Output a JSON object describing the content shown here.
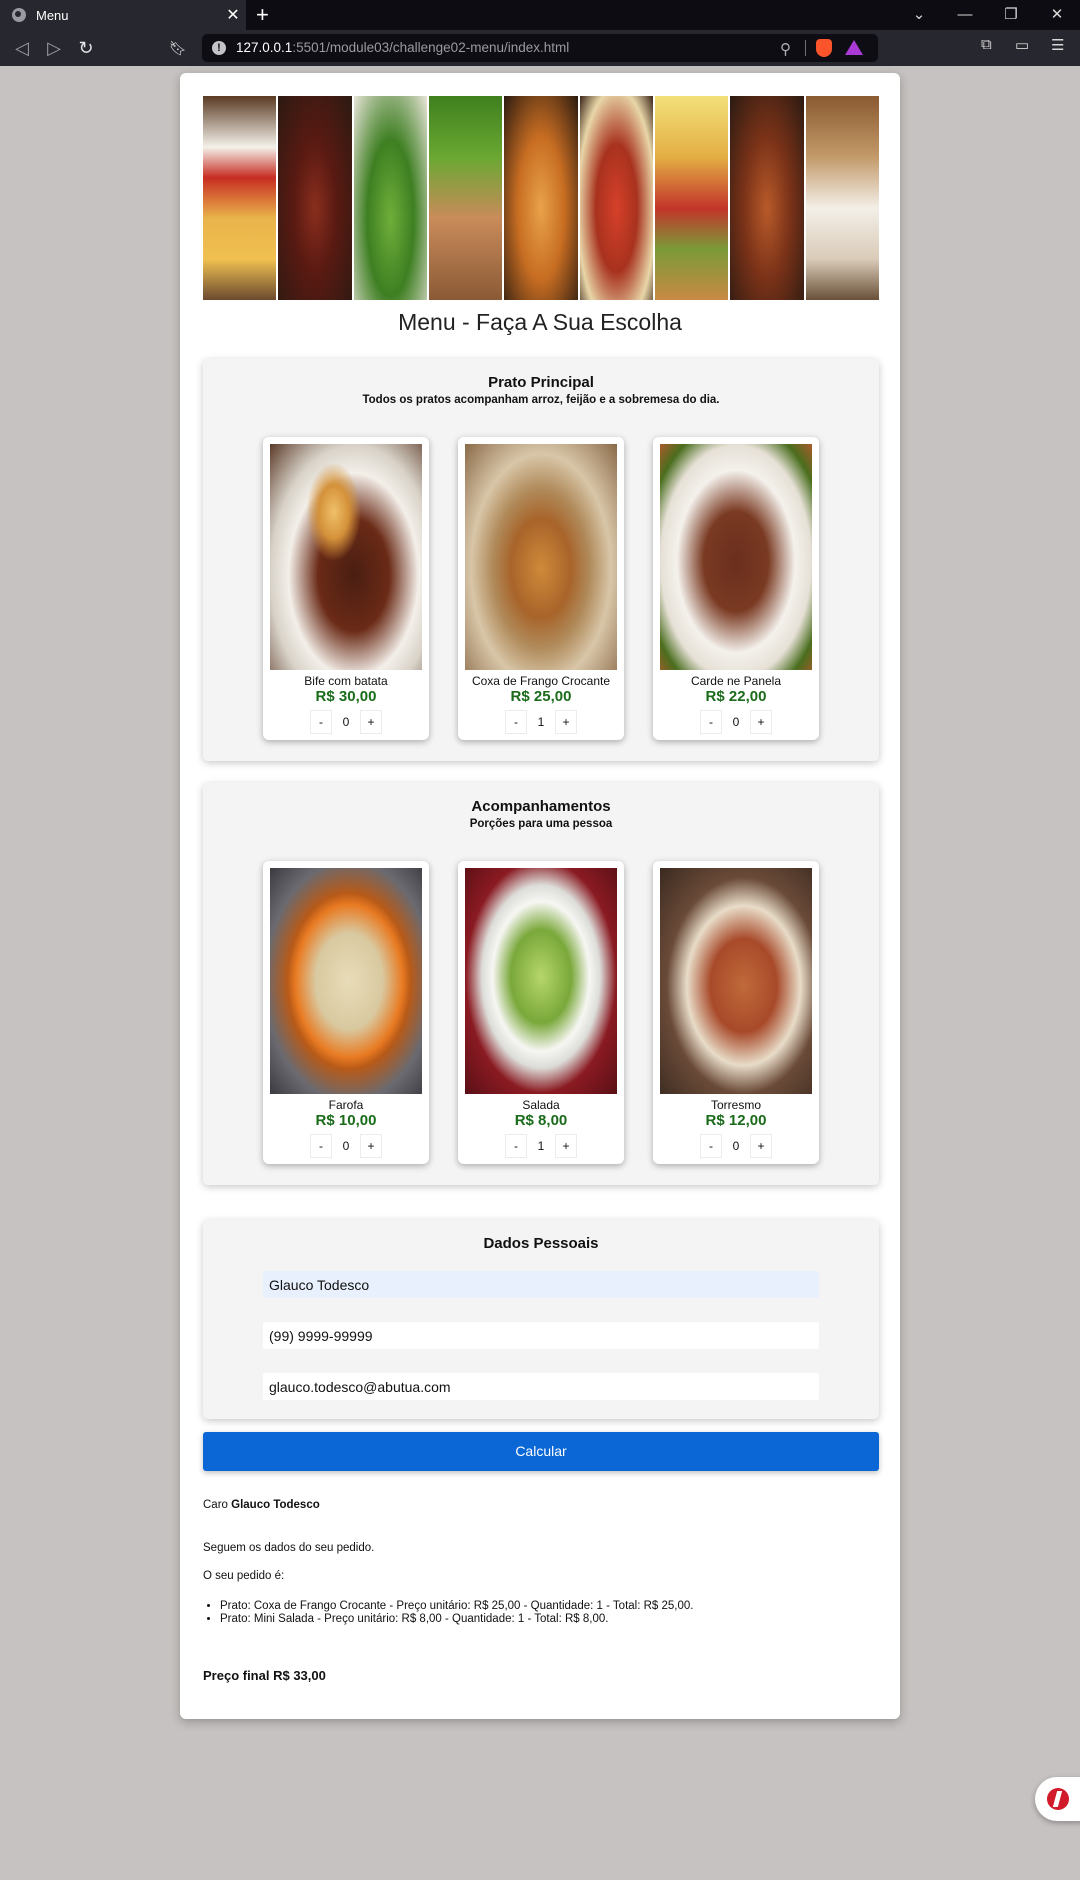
{
  "browser": {
    "tab_title": "Menu",
    "tab_close": "✕",
    "new_tab": "+",
    "url_host": "127.0.0.1",
    "url_path": ":5501/module03/challenge02-menu/index.html",
    "info_icon": "!",
    "zoom_icon": "⚲",
    "back_icon": "◁",
    "forward_icon": "▷",
    "reload_icon": "↻",
    "bookmark_icon": "🔖︎",
    "extensions_icon": "⧉",
    "wallet_icon": "▭",
    "menu_icon": "☰",
    "chevron_icon": "⌄",
    "minimize_icon": "—",
    "restore_icon": "❐",
    "close_icon": "✕"
  },
  "page": {
    "title": "Menu - Faça A Sua Escolha"
  },
  "main_dishes": {
    "title": "Prato Principal",
    "subtitle": "Todos os pratos acompanham arroz, feijão e a sobremesa do dia.",
    "items": [
      {
        "name": "Bife com batata",
        "price": "R$ 30,00",
        "qty": "0",
        "minus": "-",
        "plus": "+"
      },
      {
        "name": "Coxa de Frango Crocante",
        "price": "R$ 25,00",
        "qty": "1",
        "minus": "-",
        "plus": "+"
      },
      {
        "name": "Carde ne Panela",
        "price": "R$ 22,00",
        "qty": "0",
        "minus": "-",
        "plus": "+"
      }
    ]
  },
  "sides": {
    "title": "Acompanhamentos",
    "subtitle": "Porções para uma pessoa",
    "items": [
      {
        "name": "Farofa",
        "price": "R$ 10,00",
        "qty": "0",
        "minus": "-",
        "plus": "+"
      },
      {
        "name": "Salada",
        "price": "R$ 8,00",
        "qty": "1",
        "minus": "-",
        "plus": "+"
      },
      {
        "name": "Torresmo",
        "price": "R$ 12,00",
        "qty": "0",
        "minus": "-",
        "plus": "+"
      }
    ]
  },
  "personal": {
    "title": "Dados Pessoais",
    "name_value": "Glauco Todesco",
    "phone_value": "(99) 9999-99999",
    "email_value": "glauco.todesco@abutua.com"
  },
  "calc_button": "Calcular",
  "result": {
    "greeting_prefix": "Caro",
    "customer_name": "Glauco Todesco",
    "line1": "Seguem os dados do seu pedido.",
    "line2": "O seu pedido é:",
    "items": [
      "Prato: Coxa de Frango Crocante - Preço unitário: R$ 25,00 - Quantidade: 1 - Total: R$ 25,00.",
      "Prato: Mini Salada - Preço unitário: R$ 8,00 - Quantidade: 1 - Total: R$ 8,00."
    ],
    "final_label": "Preço final",
    "final_value": "R$ 33,00"
  }
}
